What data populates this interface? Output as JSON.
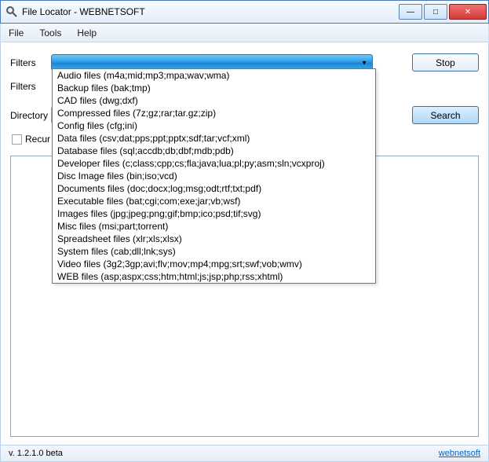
{
  "window": {
    "title": "File Locator - WEBNETSOFT"
  },
  "menu": {
    "file": "File",
    "tools": "Tools",
    "help": "Help"
  },
  "labels": {
    "filters1": "Filters",
    "filters2": "Filters",
    "directory": "Directory",
    "recursive": "Recur"
  },
  "buttons": {
    "stop": "Stop",
    "search": "Search",
    "minimize": "—",
    "maximize": "□",
    "close": "✕"
  },
  "dropdown": {
    "items": [
      "Audio files (m4a;mid;mp3;mpa;wav;wma)",
      "Backup files (bak;tmp)",
      "CAD files (dwg;dxf)",
      "Compressed files (7z;gz;rar;tar.gz;zip)",
      "Config files (cfg;ini)",
      "Data files (csv;dat;pps;ppt;pptx;sdf;tar;vcf;xml)",
      "Database files (sql;accdb;db;dbf;mdb;pdb)",
      "Developer files (c;class;cpp;cs;fla;java;lua;pl;py;asm;sln;vcxproj)",
      "Disc Image files (bin;iso;vcd)",
      "Documents files (doc;docx;log;msg;odt;rtf;txt;pdf)",
      "Executable files (bat;cgi;com;exe;jar;vb;wsf)",
      "Images files (jpg;jpeg;png;gif;bmp;ico;psd;tif;svg)",
      "Misc files (msi;part;torrent)",
      "Spreadsheet files (xlr;xls;xlsx)",
      "System files (cab;dll;lnk;sys)",
      "Video files (3g2;3gp;avi;flv;mov;mp4;mpg;srt;swf;vob;wmv)",
      "WEB files (asp;aspx;css;htm;html;js;jsp;php;rss;xhtml)"
    ]
  },
  "footer": {
    "version": "v. 1.2.1.0 beta",
    "link": "webnetsoft"
  }
}
